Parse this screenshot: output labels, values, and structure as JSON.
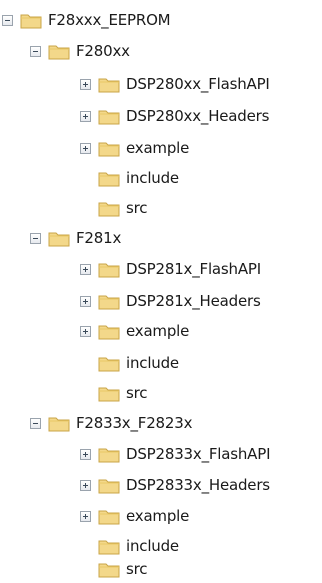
{
  "tree": {
    "root": {
      "label": "F28xxx_EEPROM",
      "expander": "minus",
      "icon": "folder-icon"
    },
    "groups": [
      {
        "label": "F280xx",
        "expander": "minus",
        "children": [
          {
            "label": "DSP280xx_FlashAPI",
            "expander": "plus"
          },
          {
            "label": "DSP280xx_Headers",
            "expander": "plus"
          },
          {
            "label": "example",
            "expander": "plus"
          },
          {
            "label": "include",
            "expander": "none"
          },
          {
            "label": "src",
            "expander": "none"
          }
        ]
      },
      {
        "label": "F281x",
        "expander": "minus",
        "children": [
          {
            "label": "DSP281x_FlashAPI",
            "expander": "plus"
          },
          {
            "label": "DSP281x_Headers",
            "expander": "plus"
          },
          {
            "label": "example",
            "expander": "plus"
          },
          {
            "label": "include",
            "expander": "none"
          },
          {
            "label": "src",
            "expander": "none"
          }
        ]
      },
      {
        "label": "F2833x_F2823x",
        "expander": "minus",
        "children": [
          {
            "label": "DSP2833x_FlashAPI",
            "expander": "plus"
          },
          {
            "label": "DSP2833x_Headers",
            "expander": "plus"
          },
          {
            "label": "example",
            "expander": "plus"
          },
          {
            "label": "include",
            "expander": "none"
          },
          {
            "label": "src",
            "expander": "none"
          }
        ]
      }
    ]
  },
  "colors": {
    "folder_fill": "#f3d88a",
    "folder_edge": "#c9a447",
    "folder_tab": "#e9c866"
  }
}
